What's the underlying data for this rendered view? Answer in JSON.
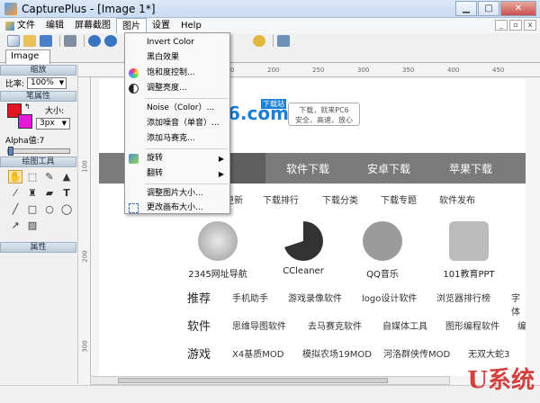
{
  "window": {
    "title": "CapturePlus - [Image 1*]"
  },
  "menubar": {
    "items": [
      "文件",
      "编辑",
      "屏幕截图",
      "图片",
      "设置",
      "Help"
    ]
  },
  "doc_tab": "Image 1*",
  "left_panel": {
    "zoom_header": "缩放",
    "zoom_label": "比率:",
    "zoom_value": "100%",
    "props_header": "笔属性",
    "size_label": "大小:",
    "size_value": "3px",
    "alpha_label": "Alpha值:7",
    "tools_header": "绘图工具",
    "attrs_header": "属性",
    "primary_color": "#e8141f",
    "secondary_color": "#e619d6"
  },
  "ruler": {
    "top_marks": [
      "50",
      "100",
      "150",
      "200",
      "250",
      "300",
      "350",
      "400",
      "450"
    ],
    "left_marks": [
      "100",
      "200",
      "300",
      "400"
    ]
  },
  "dropdown": {
    "items": [
      {
        "label": "Invert Color"
      },
      {
        "label": "黑白效果"
      },
      {
        "label": "饱和度控制..."
      },
      {
        "label": "调整亮度..."
      },
      {
        "label": "Noise（Color）..."
      },
      {
        "label": "添加噪音（单音）..."
      },
      {
        "label": "添加马赛克..."
      },
      {
        "label": "旋转"
      },
      {
        "label": "翻转"
      },
      {
        "label": "调整图片大小..."
      },
      {
        "label": "更改画布大小..."
      }
    ]
  },
  "canvas_image": {
    "logo": "6.com",
    "logo_badge": "下载站",
    "logo_bubble_line1": "下载，就来PC6",
    "logo_bubble_line2": "安全、高速、放心",
    "nav_first": "页",
    "nav": [
      "软件下载",
      "安卓下载",
      "苹果下载"
    ],
    "subnav": [
      "更新",
      "下载排行",
      "下载分类",
      "下载专题",
      "软件发布"
    ],
    "icons": [
      {
        "label": "2345网址导航"
      },
      {
        "label": "CCleaner"
      },
      {
        "label": "QQ音乐"
      },
      {
        "label": "101教育PPT"
      }
    ],
    "rows": [
      {
        "label": "推荐",
        "tags": [
          "手机助手",
          "游戏录像软件",
          "logo设计软件",
          "浏览器排行榜",
          "字体"
        ]
      },
      {
        "label": "软件",
        "tags": [
          "思维导图软件",
          "去马赛克软件",
          "自媒体工具",
          "图形编程软件",
          "编"
        ]
      },
      {
        "label": "游戏",
        "tags": [
          "X4基质MOD",
          "模拟农场19MOD",
          "河洛群侠传MOD",
          "无双大蛇3"
        ]
      }
    ]
  },
  "watermark": "U系统"
}
